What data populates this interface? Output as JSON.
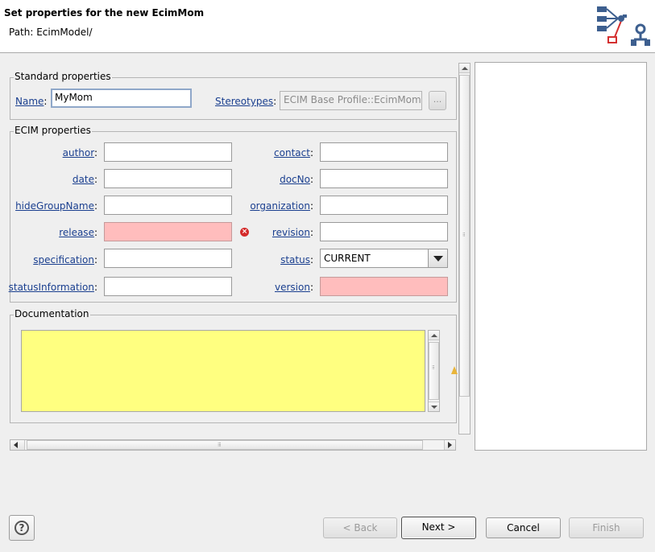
{
  "header": {
    "title": "Set properties for the new EcimMom",
    "path": "Path:  EcimModel/"
  },
  "standard": {
    "legend": "Standard properties",
    "name_label": "Name",
    "name_value": "MyMom",
    "stereotypes_label": "Stereotypes",
    "stereotypes_value": "ECIM Base Profile::EcimMom",
    "browse_label": "..."
  },
  "ecim": {
    "legend": "ECIM properties",
    "left": [
      {
        "label": "author",
        "value": ""
      },
      {
        "label": "date",
        "value": ""
      },
      {
        "label": "hideGroupName",
        "value": ""
      },
      {
        "label": "release",
        "value": ""
      },
      {
        "label": "specification",
        "value": ""
      },
      {
        "label": "statusInformation",
        "value": ""
      }
    ],
    "right": [
      {
        "label": "contact",
        "value": ""
      },
      {
        "label": "docNo",
        "value": ""
      },
      {
        "label": "organization",
        "value": ""
      },
      {
        "label": "revision",
        "value": ""
      },
      {
        "label": "status",
        "value": "CURRENT"
      },
      {
        "label": "version",
        "value": ""
      }
    ],
    "colon": ":"
  },
  "documentation": {
    "legend": "Documentation",
    "value": ""
  },
  "buttons": {
    "back": "< Back",
    "next": "Next >",
    "cancel": "Cancel",
    "finish": "Finish"
  },
  "colors": {
    "error_field": "#ffbdbd",
    "doc_background": "#ffff80",
    "link": "#1a3f8f"
  },
  "icons": {
    "help": "help-icon",
    "error": "error-icon",
    "warning": "warning-icon",
    "logo": "ecim-mom-logo"
  }
}
